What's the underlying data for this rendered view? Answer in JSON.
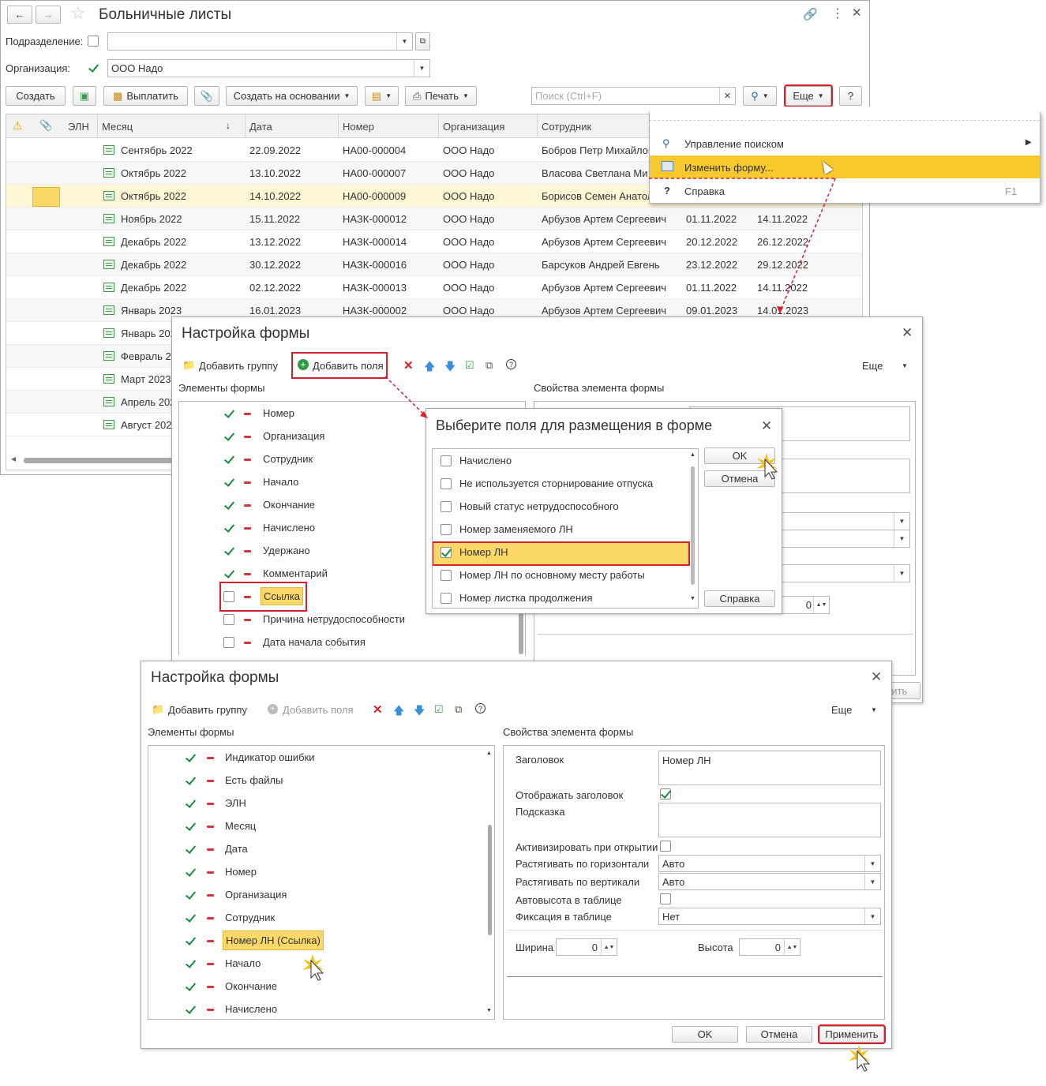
{
  "main": {
    "title": "Больничные листы",
    "filter_dept_label": "Подразделение:",
    "filter_org_label": "Организация:",
    "filter_org_value": "ООО Надо",
    "toolbar": {
      "create": "Создать",
      "pay": "Выплатить",
      "create_based": "Создать на основании",
      "print": "Печать",
      "search_placeholder": "Поиск (Ctrl+F)",
      "more": "Еще",
      "help": "?"
    },
    "columns": [
      "ЭЛН",
      "Месяц",
      "Дата",
      "Номер",
      "Организация",
      "Сотрудник"
    ],
    "rows": [
      {
        "month": "Сентябрь 2022",
        "date": "22.09.2022",
        "num": "НА00-000004",
        "org": "ООО Надо",
        "emp": "Бобров Петр Михайлов",
        "start": "",
        "end": ""
      },
      {
        "month": "Октябрь 2022",
        "date": "13.10.2022",
        "num": "НА00-000007",
        "org": "ООО Надо",
        "emp": "Власова Светлана Ми",
        "start": "",
        "end": ""
      },
      {
        "month": "Октябрь 2022",
        "date": "14.10.2022",
        "num": "НА00-000009",
        "org": "ООО Надо",
        "emp": "Борисов Семен Анатол",
        "start": "",
        "end": ""
      },
      {
        "month": "Ноябрь 2022",
        "date": "15.11.2022",
        "num": "НАЗК-000012",
        "org": "ООО Надо",
        "emp": "Арбузов Артем Сергеевич",
        "start": "01.11.2022",
        "end": "14.11.2022"
      },
      {
        "month": "Декабрь 2022",
        "date": "13.12.2022",
        "num": "НАЗК-000014",
        "org": "ООО Надо",
        "emp": "Арбузов Артем Сергеевич",
        "start": "20.12.2022",
        "end": "26.12.2022"
      },
      {
        "month": "Декабрь 2022",
        "date": "30.12.2022",
        "num": "НАЗК-000016",
        "org": "ООО Надо",
        "emp": "Барсуков Андрей Евгень",
        "start": "23.12.2022",
        "end": "29.12.2022"
      },
      {
        "month": "Декабрь 2022",
        "date": "02.12.2022",
        "num": "НАЗК-000013",
        "org": "ООО Надо",
        "emp": "Арбузов Артем Сергеевич",
        "start": "01.11.2022",
        "end": "14.11.2022"
      },
      {
        "month": "Январь 2023",
        "date": "16.01.2023",
        "num": "НАЗК-000002",
        "org": "ООО Надо",
        "emp": "Арбузов Артем Сергеевич",
        "start": "09.01.2023",
        "end": "14.01.2023"
      },
      {
        "month": "Январь 202",
        "date": "",
        "num": "",
        "org": "",
        "emp": "",
        "start": "",
        "end": ""
      },
      {
        "month": "Февраль 2",
        "date": "",
        "num": "",
        "org": "",
        "emp": "",
        "start": "",
        "end": ""
      },
      {
        "month": "Март 2023",
        "date": "",
        "num": "",
        "org": "",
        "emp": "",
        "start": "",
        "end": ""
      },
      {
        "month": "Апрель 202",
        "date": "",
        "num": "",
        "org": "",
        "emp": "",
        "start": "",
        "end": ""
      },
      {
        "month": "Август 202",
        "date": "",
        "num": "",
        "org": "",
        "emp": "",
        "start": "",
        "end": ""
      }
    ]
  },
  "context_menu": {
    "items": [
      {
        "label": "Управление поиском",
        "shortcut": ""
      },
      {
        "label": "Изменить форму...",
        "shortcut": ""
      },
      {
        "label": "Справка",
        "shortcut": "F1"
      }
    ]
  },
  "form1": {
    "title": "Настройка формы",
    "add_group": "Добавить группу",
    "add_fields": "Добавить поля",
    "more": "Еще",
    "elements_label": "Элементы формы",
    "props_label": "Свойства элемента формы",
    "items": [
      {
        "label": "Номер",
        "checked": true
      },
      {
        "label": "Организация",
        "checked": true
      },
      {
        "label": "Сотрудник",
        "checked": true
      },
      {
        "label": "Начало",
        "checked": true
      },
      {
        "label": "Окончание",
        "checked": true
      },
      {
        "label": "Начислено",
        "checked": true
      },
      {
        "label": "Удержано",
        "checked": true
      },
      {
        "label": "Комментарий",
        "checked": true
      },
      {
        "label": "Ссылка",
        "checked": false
      },
      {
        "label": "Причина нетрудоспособности",
        "checked": false
      },
      {
        "label": "Дата начала события",
        "checked": false
      }
    ],
    "width_value": "0",
    "apply_partial": "инить"
  },
  "fields_dialog": {
    "title": "Выберите поля для размещения в форме",
    "items": [
      {
        "label": "Начислено",
        "checked": false
      },
      {
        "label": "Не используется сторнирование отпуска",
        "checked": false
      },
      {
        "label": "Новый статус нетрудоспособного",
        "checked": false
      },
      {
        "label": "Номер заменяемого ЛН",
        "checked": false
      },
      {
        "label": "Номер ЛН",
        "checked": true
      },
      {
        "label": "Номер ЛН по основному месту работы",
        "checked": false
      },
      {
        "label": "Номер листка продолжения",
        "checked": false
      }
    ],
    "ok": "OK",
    "cancel": "Отмена",
    "help": "Справка"
  },
  "form2": {
    "title": "Настройка формы",
    "add_group": "Добавить группу",
    "add_fields": "Добавить поля",
    "more": "Еще",
    "elements_label": "Элементы формы",
    "props_label": "Свойства элемента формы",
    "items": [
      {
        "label": "Индикатор ошибки"
      },
      {
        "label": "Есть файлы"
      },
      {
        "label": "ЭЛН"
      },
      {
        "label": "Месяц"
      },
      {
        "label": "Дата"
      },
      {
        "label": "Номер"
      },
      {
        "label": "Организация"
      },
      {
        "label": "Сотрудник"
      },
      {
        "label": "Номер ЛН (Ссылка)"
      },
      {
        "label": "Начало"
      },
      {
        "label": "Окончание"
      },
      {
        "label": "Начислено"
      }
    ],
    "props": {
      "caption_label": "Заголовок",
      "caption_value": "Номер ЛН",
      "show_caption_label": "Отображать заголовок",
      "hint_label": "Подсказка",
      "activate_label": "Активизировать при открытии",
      "stretch_h_label": "Растягивать по горизонтали",
      "stretch_h_value": "Авто",
      "stretch_v_label": "Растягивать по вертикали",
      "stretch_v_value": "Авто",
      "autoheight_label": "Автовысота в таблице",
      "fix_label": "Фиксация в таблице",
      "fix_value": "Нет",
      "width_label": "Ширина",
      "width_value": "0",
      "height_label": "Высота",
      "height_value": "0"
    },
    "ok": "OK",
    "cancel": "Отмена",
    "apply": "Применить"
  }
}
